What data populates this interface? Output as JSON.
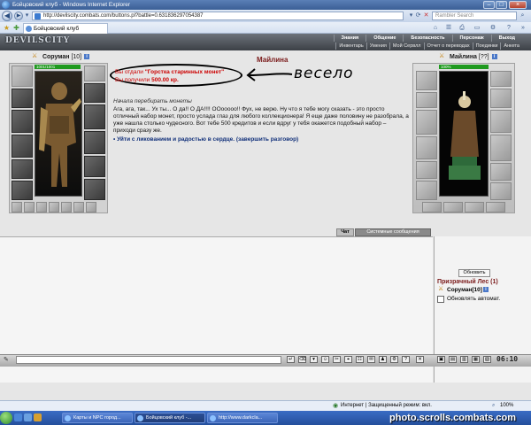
{
  "window": {
    "title": "Бойцовский клуб - Windows Internet Explorer"
  },
  "browser": {
    "url": "http://devilscity.combats.com/buttons.pl?battle=0.631836297054387",
    "search_placeholder": "Rambler Search",
    "tab_title": "Бойцовский клуб"
  },
  "game": {
    "logo": "DEVILSCITY",
    "menu_main": [
      "Знания",
      "Общение",
      "Безопасность",
      "Персонаж",
      "Выход"
    ],
    "menu_sub": [
      "Инвентарь",
      "Умения",
      "Мой Сервлл",
      "Отчет о переводах",
      "Поединки",
      "Анкета"
    ],
    "player": {
      "name": "Соруман",
      "level": "[10]",
      "hp": "1001/1001"
    },
    "npc": {
      "name": "Майлина",
      "level": "[??]",
      "hp": "100%"
    },
    "dialog": {
      "npc_title": "Майлина",
      "gave_prefix": "Вы отдали ",
      "gave_item": "\"Горстка старинных монет\"",
      "received_prefix": "Вы получили ",
      "received_amount": "500.00 кр.",
      "annotation": "весело",
      "speech_title": "Начала перебирать монеты",
      "speech_text": "Ага, ага, так... Ух ты... О да!! О ДА!!!! ООоoooo!! Фух, не верю. Ну что я тебе могу сказать - это просто отличный набор монет, просто услада глаз для любого коллекционера! Я еще даже половину не разобрала, а уже нашла столько чудесного. Вот тебе 500 кредитов и если вдруг у тебя окажется подобный набор – приходи сразу же.",
      "exit_link": "Уйти с ликованием и радостью в сердце. (завершить разговор)"
    },
    "chat": {
      "tab_chat": "Чат",
      "tab_system": "Системные сообщения",
      "refresh_button": "Обновить",
      "location": "Призрачный Лес (1)",
      "user": "Соруман[10]",
      "auto_refresh_label": "Обновлять автомат."
    },
    "clock": "06:10"
  },
  "statusbar": {
    "zone": "Интернет | Защищенный режим: вкл.",
    "zoom": "100%"
  },
  "taskbar": {
    "tasks": [
      "Карты и NPC город...",
      "Бойцовский клуб -...",
      "http://www.darkcla..."
    ],
    "watermark": "photo.scrolls.combats.com"
  }
}
